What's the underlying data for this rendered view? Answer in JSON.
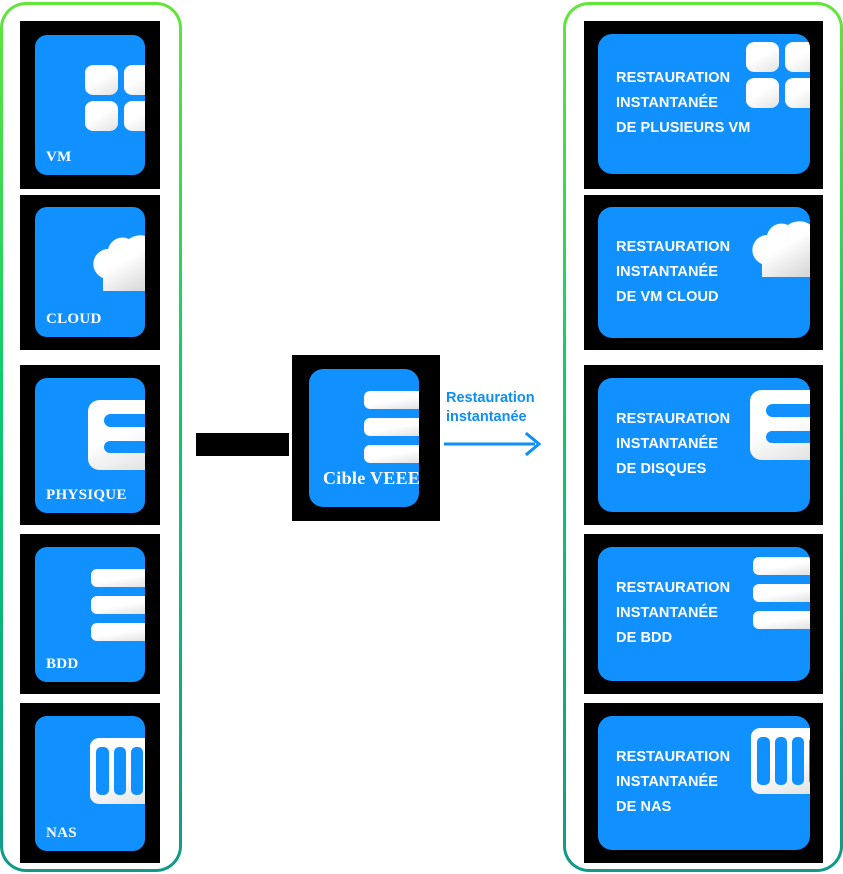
{
  "theme": {
    "card_blue": "#1190ff",
    "tile_black": "#000000",
    "frame_gradient_top": "#63e53a",
    "frame_gradient_mid": "#0ccc6e",
    "frame_gradient_bottom": "#0f9a88",
    "arrow_blue": "#0d8ff5",
    "text_white": "#ffffff",
    "background": "#ffffff"
  },
  "left_column": {
    "name": "sources",
    "items": [
      {
        "label": "VM",
        "icon": "vm-grid-icon"
      },
      {
        "label": "CLOUD",
        "icon": "cloud-icon"
      },
      {
        "label": "PHYSIQUE",
        "icon": "server-e-icon"
      },
      {
        "label": "BDD",
        "icon": "database-bars-icon"
      },
      {
        "label": "NAS",
        "icon": "nas-bays-icon"
      }
    ]
  },
  "center": {
    "card": {
      "label_line1": "Cible",
      "label_line2": "VEEEAM",
      "icon": "database-bars-icon"
    },
    "connector": "black-bar-connector"
  },
  "arrow": {
    "caption_line1": "Restauration",
    "caption_line2": "instantanée",
    "icon": "arrow-right-icon"
  },
  "right_column": {
    "name": "instant-restore-targets",
    "items": [
      {
        "line1": "RESTAURATION",
        "line2": "INSTANTANÉE",
        "line3": "DE PLUSIEURS VM",
        "icon": "vm-grid-icon"
      },
      {
        "line1": "RESTAURATION",
        "line2": "INSTANTANÉE",
        "line3": "DE VM CLOUD",
        "icon": "cloud-icon"
      },
      {
        "line1": "RESTAURATION",
        "line2": "INSTANTANÉE",
        "line3": "DE DISQUES",
        "icon": "server-e-icon"
      },
      {
        "line1": "RESTAURATION",
        "line2": "INSTANTANÉE",
        "line3": "DE BDD",
        "icon": "database-bars-icon"
      },
      {
        "line1": "RESTAURATION",
        "line2": "INSTANTANÉE",
        "line3": "DE NAS",
        "icon": "nas-bays-icon"
      }
    ]
  }
}
